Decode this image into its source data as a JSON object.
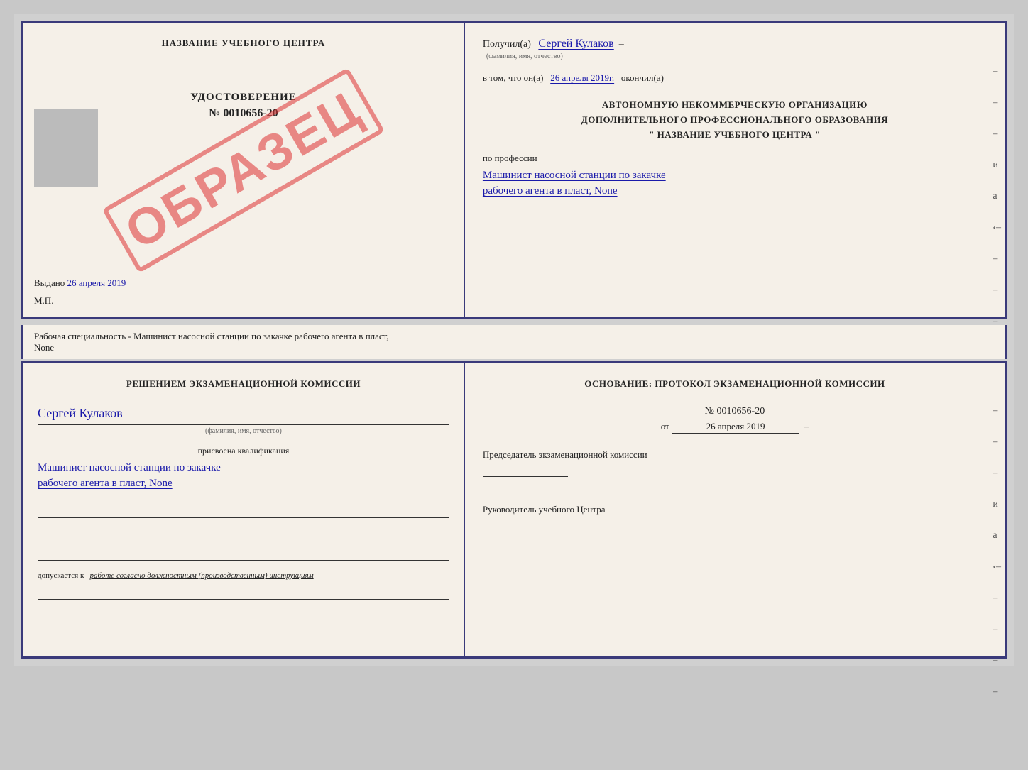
{
  "page": {
    "background": "#c8c8c8"
  },
  "topCert": {
    "left": {
      "centerName": "НАЗВАНИЕ УЧЕБНОГО ЦЕНТРА",
      "certTitle": "УДОСТОВЕРЕНИЕ",
      "certNumber": "№ 0010656-20",
      "issuedLabel": "Выдано",
      "issuedDate": "26 апреля 2019",
      "mpLabel": "М.П.",
      "stampText": "ОБРАЗЕЦ"
    },
    "right": {
      "receivedLabel": "Получил(а)",
      "receivedName": "Сергей Кулаков",
      "receivedSubtitle": "(фамилия, имя, отчество)",
      "dateLabel": "в том, что он(а)",
      "date": "26 апреля 2019г.",
      "dateEndLabel": "окончил(а)",
      "orgLine1": "АВТОНОМНУЮ НЕКОММЕРЧЕСКУЮ ОРГАНИЗАЦИЮ",
      "orgLine2": "ДОПОЛНИТЕЛЬНОГО ПРОФЕССИОНАЛЬНОГО ОБРАЗОВАНИЯ",
      "orgLine3": "\"  НАЗВАНИЕ УЧЕБНОГО ЦЕНТРА  \"",
      "profLabel": "по профессии",
      "profLine1": "Машинист насосной станции по закачке",
      "profLine2": "рабочего агента в пласт, None"
    }
  },
  "separator": {
    "text": "Рабочая специальность - Машинист насосной станции по закачке рабочего агента в пласт,",
    "text2": "None"
  },
  "bottomCert": {
    "left": {
      "decisionText": "Решением экзаменационной комиссии",
      "personName": "Сергей Кулаков",
      "personSubtitle": "(фамилия, имя, отчество)",
      "qualLabel": "присвоена квалификация",
      "qualLine1": "Машинист насосной станции по закачке",
      "qualLine2": "рабочего агента в пласт, None",
      "допускLabel": "допускается к",
      "допускText": "работе согласно должностным (производственным) инструкциям"
    },
    "right": {
      "osnovTitle": "Основание: протокол экзаменационной комиссии",
      "protocolNumber": "№ 0010656-20",
      "protocolDateLabel": "от",
      "protocolDate": "26 апреля 2019",
      "chairmanTitle": "Председатель экзаменационной комиссии",
      "rukovTitle": "Руководитель учебного Центра"
    }
  }
}
